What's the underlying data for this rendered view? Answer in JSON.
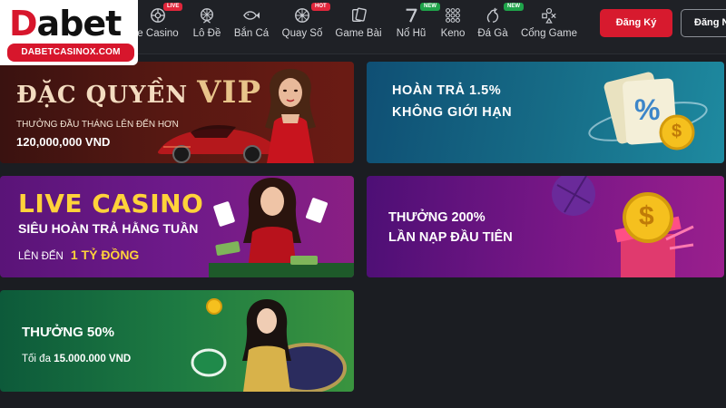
{
  "logo": {
    "brand": "Dabet",
    "brand_initial": "D",
    "brand_rest": "abet",
    "domain": "DABETCASINOX.COM"
  },
  "nav": {
    "items": [
      {
        "label": "e Casino",
        "icon": "roulette-wheel-icon",
        "badge": "LIVE"
      },
      {
        "label": "Lô Đề",
        "icon": "ferris-wheel-icon",
        "badge": ""
      },
      {
        "label": "Bắn Cá",
        "icon": "fish-icon",
        "badge": ""
      },
      {
        "label": "Quay Số",
        "icon": "lottery-wheel-icon",
        "badge": "HOT"
      },
      {
        "label": "Game Bài",
        "icon": "cards-icon",
        "badge": ""
      },
      {
        "label": "Nổ Hũ",
        "icon": "slot-seven-icon",
        "badge": "NEW"
      },
      {
        "label": "Keno",
        "icon": "keno-grid-icon",
        "badge": ""
      },
      {
        "label": "Đá Gà",
        "icon": "rooster-icon",
        "badge": "NEW"
      },
      {
        "label": "Cổng Game",
        "icon": "gamepad-shapes-icon",
        "badge": ""
      }
    ]
  },
  "auth": {
    "register": "Đăng Ký",
    "login": "Đăng Nhập"
  },
  "banners": {
    "vip": {
      "title_prefix": "ĐẶC QUYỀN",
      "title_big": "VIP",
      "subtitle": "THƯỞNG ĐẦU THÁNG LÊN ĐẾN HƠN",
      "amount": "120,000,000 VND"
    },
    "cashback": {
      "line1": "HOÀN TRẢ 1.5%",
      "line2": "KHÔNG GIỚI HẠN",
      "coin_symbol": "$",
      "percent_symbol": "%"
    },
    "live_casino": {
      "title": "LIVE CASINO",
      "subtitle": "SIÊU HOÀN TRẢ HẰNG TUẦN",
      "amount_prefix": "LÊN ĐẾN",
      "amount": "1 TỶ ĐỒNG"
    },
    "deposit": {
      "line1": "THƯỞNG 200%",
      "line2": "LẦN NẠP ĐẦU TIÊN",
      "coin_symbol": "$"
    },
    "bonus50": {
      "line1": "THƯỞNG 50%",
      "line2_prefix": "Tối đa",
      "line2_amount": "15.000.000 VND"
    }
  },
  "colors": {
    "brand_red": "#d71a2e",
    "gold": "#ffd23a",
    "live_badge": "#e0263b",
    "new_badge": "#1fa34a"
  }
}
